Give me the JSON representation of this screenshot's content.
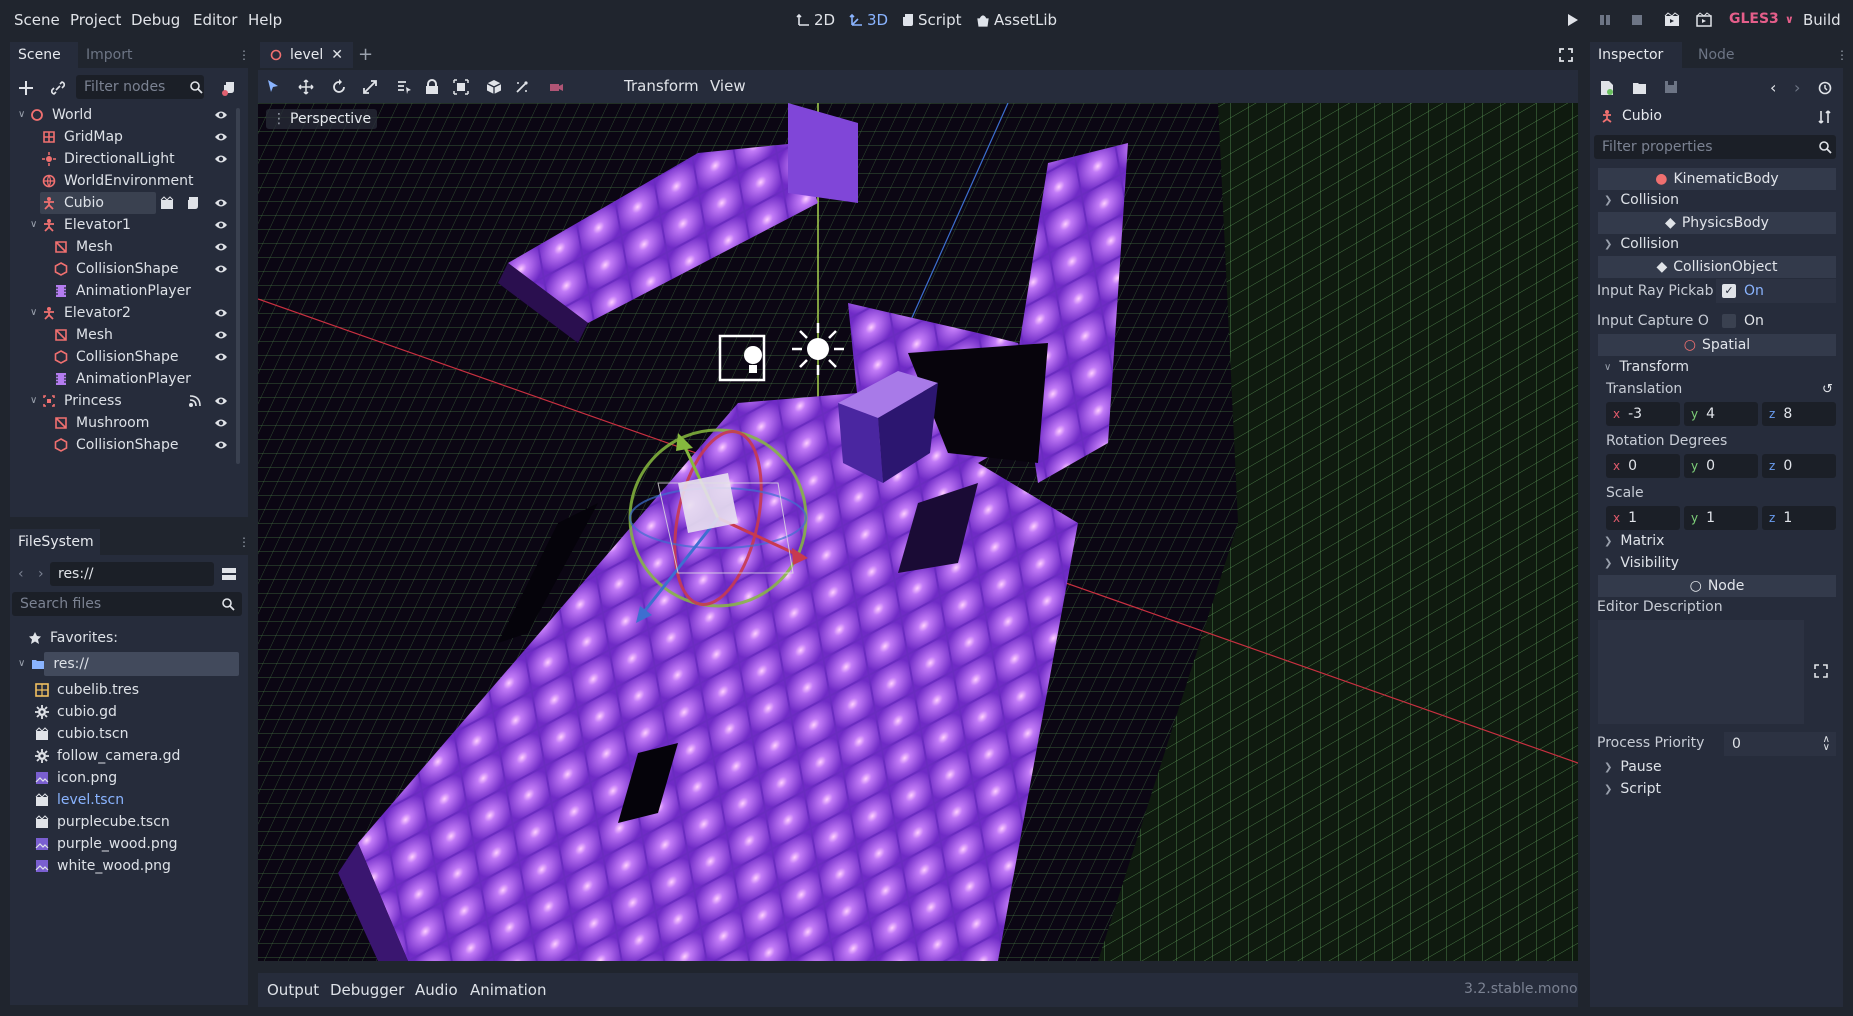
{
  "menu": [
    "Scene",
    "Project",
    "Debug",
    "Editor",
    "Help"
  ],
  "modes": [
    {
      "label": "2D",
      "active": false
    },
    {
      "label": "3D",
      "active": true
    },
    {
      "label": "Script",
      "active": false
    },
    {
      "label": "AssetLib",
      "active": false
    }
  ],
  "renderer": "GLES3",
  "build_label": "Build",
  "scene_dock": {
    "tabs": [
      "Scene",
      "Import"
    ],
    "filter_placeholder": "Filter nodes",
    "tree": [
      {
        "label": "World",
        "icon": "spatial-icon",
        "depth": 0,
        "collapsible": true,
        "color": "#f07070"
      },
      {
        "label": "GridMap",
        "icon": "gridmap-icon",
        "depth": 1,
        "color": "#f07070"
      },
      {
        "label": "DirectionalLight",
        "icon": "light-icon",
        "depth": 1,
        "color": "#f07070"
      },
      {
        "label": "WorldEnvironment",
        "icon": "environment-icon",
        "depth": 1,
        "color": "#f07070"
      },
      {
        "label": "Cubio",
        "icon": "kinematic-body-icon",
        "depth": 1,
        "selected": true,
        "color": "#f07070"
      },
      {
        "label": "Elevator1",
        "icon": "kinematic-body-icon",
        "depth": 1,
        "collapsible": true,
        "color": "#f07070"
      },
      {
        "label": "Mesh",
        "icon": "mesh-icon",
        "depth": 2,
        "color": "#f07070"
      },
      {
        "label": "CollisionShape",
        "icon": "collision-shape-icon",
        "depth": 2,
        "color": "#f07070"
      },
      {
        "label": "AnimationPlayer",
        "icon": "animation-player-icon",
        "depth": 2,
        "color": "#b47cf0"
      },
      {
        "label": "Elevator2",
        "icon": "kinematic-body-icon",
        "depth": 1,
        "collapsible": true,
        "color": "#f07070"
      },
      {
        "label": "Mesh",
        "icon": "mesh-icon",
        "depth": 2,
        "color": "#f07070"
      },
      {
        "label": "CollisionShape",
        "icon": "collision-shape-icon",
        "depth": 2,
        "color": "#f07070"
      },
      {
        "label": "AnimationPlayer",
        "icon": "animation-player-icon",
        "depth": 2,
        "color": "#b47cf0"
      },
      {
        "label": "Princess",
        "icon": "area-icon",
        "depth": 1,
        "collapsible": true,
        "color": "#f07070"
      },
      {
        "label": "Mushroom",
        "icon": "mesh-icon",
        "depth": 2,
        "color": "#f07070"
      },
      {
        "label": "CollisionShape",
        "icon": "collision-shape-icon",
        "depth": 2,
        "color": "#f07070"
      }
    ]
  },
  "filesystem": {
    "tab": "FileSystem",
    "path": "res://",
    "search_placeholder": "Search files",
    "favorites_label": "Favorites:",
    "root_label": "res://",
    "files": [
      {
        "label": "cubelib.tres",
        "icon": "mesh-library-icon",
        "highlight": false
      },
      {
        "label": "cubio.gd",
        "icon": "gear-icon",
        "highlight": false
      },
      {
        "label": "cubio.tscn",
        "icon": "scene-icon",
        "highlight": false
      },
      {
        "label": "follow_camera.gd",
        "icon": "gear-icon",
        "highlight": false
      },
      {
        "label": "icon.png",
        "icon": "image-icon",
        "highlight": false
      },
      {
        "label": "level.tscn",
        "icon": "scene-icon",
        "highlight": true
      },
      {
        "label": "purplecube.tscn",
        "icon": "scene-icon",
        "highlight": false
      },
      {
        "label": "purple_wood.png",
        "icon": "image-icon",
        "highlight": false
      },
      {
        "label": "white_wood.png",
        "icon": "image-icon",
        "highlight": false
      }
    ]
  },
  "editor_tab": "level",
  "viewport_toolbar": {
    "transform_menu": "Transform",
    "view_menu": "View"
  },
  "viewport_label": "Perspective",
  "bottom_tabs": [
    "Output",
    "Debugger",
    "Audio",
    "Animation"
  ],
  "version": "3.2.stable.mono",
  "inspector": {
    "tabs": [
      "Inspector",
      "Node"
    ],
    "object_name": "Cubio",
    "filter_placeholder": "Filter properties",
    "sections": {
      "kinematic": "KinematicBody",
      "collision1": "Collision",
      "physics": "PhysicsBody",
      "collision2": "Collision",
      "collision_object": "CollisionObject",
      "spatial": "Spatial",
      "transform": "Transform",
      "matrix": "Matrix",
      "visibility": "Visibility",
      "node": "Node",
      "pause": "Pause",
      "script": "Script"
    },
    "input_ray_pickable": {
      "label": "Input Ray Pickab",
      "value": "On",
      "checked": true
    },
    "input_capture": {
      "label": "Input Capture O",
      "value": "On",
      "checked": false
    },
    "translation": {
      "label": "Translation",
      "x": "-3",
      "y": "4",
      "z": "8"
    },
    "rotation": {
      "label": "Rotation Degrees",
      "x": "0",
      "y": "0",
      "z": "0"
    },
    "scale": {
      "label": "Scale",
      "x": "1",
      "y": "1",
      "z": "1"
    },
    "editor_description": "Editor Description",
    "process_priority": {
      "label": "Process Priority",
      "value": "0"
    }
  },
  "colors": {
    "accent": "#8ab4ff",
    "node3d": "#f07070",
    "anim": "#b47cf0"
  }
}
